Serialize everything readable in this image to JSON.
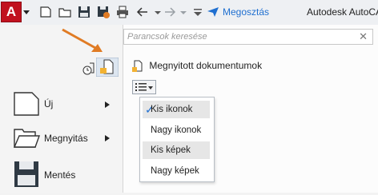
{
  "titlebar": {
    "app_letter": "A",
    "share_label": "Megosztás",
    "title": "Autodesk AutoCA"
  },
  "search": {
    "placeholder": "Parancsok keresése"
  },
  "menu": {
    "items": [
      {
        "label": "Új",
        "icon": "new-document-icon",
        "has_submenu": true
      },
      {
        "label": "Megnyitás",
        "icon": "open-folder-icon",
        "has_submenu": true
      },
      {
        "label": "Mentés",
        "icon": "save-floppy-icon",
        "has_submenu": false
      }
    ]
  },
  "documents": {
    "header": "Megnyitott dokumentumok"
  },
  "view_menu": {
    "items": [
      {
        "label": "Kis ikonok",
        "checked": true,
        "highlighted": true
      },
      {
        "label": "Nagy ikonok",
        "checked": false,
        "highlighted": false
      },
      {
        "label": "Kis képek",
        "checked": false,
        "highlighted": true
      },
      {
        "label": "Nagy képek",
        "checked": false,
        "highlighted": false
      }
    ]
  },
  "colors": {
    "accent": "#1f6fd0",
    "app_red": "#c1121f",
    "annotation_arrow": "#e07b24"
  }
}
